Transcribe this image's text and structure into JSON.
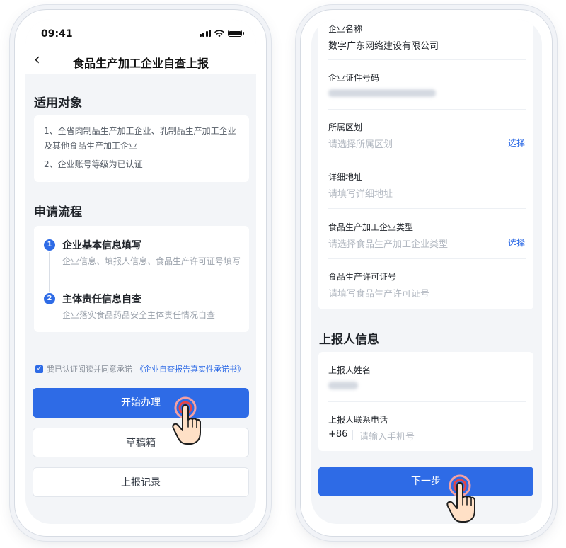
{
  "left_screen": {
    "status_time": "09:41",
    "title": "食品生产加工企业自查上报",
    "applicable": {
      "heading": "适用对象",
      "items": [
        "1、全省肉制品生产加工企业、乳制品生产加工企业",
        "及其他食品生产加工企业",
        "2、企业账号等级为已认证"
      ]
    },
    "process": {
      "heading": "申请流程",
      "steps": [
        {
          "num": "1",
          "title": "企业基本信息填写",
          "desc": "企业信息、填报人信息、食品生产许可证号填写"
        },
        {
          "num": "2",
          "title": "主体责任信息自查",
          "desc": "企业落实食品药品安全主体责任情况自查"
        }
      ]
    },
    "agreement": {
      "prefix": "我已认证阅读并同意承诺",
      "link": "《企业自查报告真实性承诺书》"
    },
    "buttons": {
      "start": "开始办理",
      "drafts": "草稿箱",
      "records": "上报记录"
    }
  },
  "right_screen": {
    "company_fields": [
      {
        "label": "企业名称",
        "value": "数字广东网络建设有限公司"
      },
      {
        "label": "企业证件号码",
        "value": ""
      },
      {
        "label": "所属区划",
        "placeholder": "请选择所属区划",
        "action": "选择"
      },
      {
        "label": "详细地址",
        "placeholder": "请填写详细地址"
      },
      {
        "label": "食品生产加工企业类型",
        "placeholder": "请选择食品生产加工企业类型",
        "action": "选择"
      },
      {
        "label": "食品生产许可证号",
        "placeholder": "请填写食品生产许可证号"
      }
    ],
    "reporter": {
      "heading": "上报人信息",
      "name_label": "上报人姓名",
      "phone_label": "上报人联系电话",
      "phone_prefix": "+86",
      "phone_placeholder": "请输入手机号"
    },
    "next_button": "下一步"
  },
  "colors": {
    "accent": "#2e6be6",
    "background": "#f3f5f8",
    "touch": "#e4454a"
  }
}
